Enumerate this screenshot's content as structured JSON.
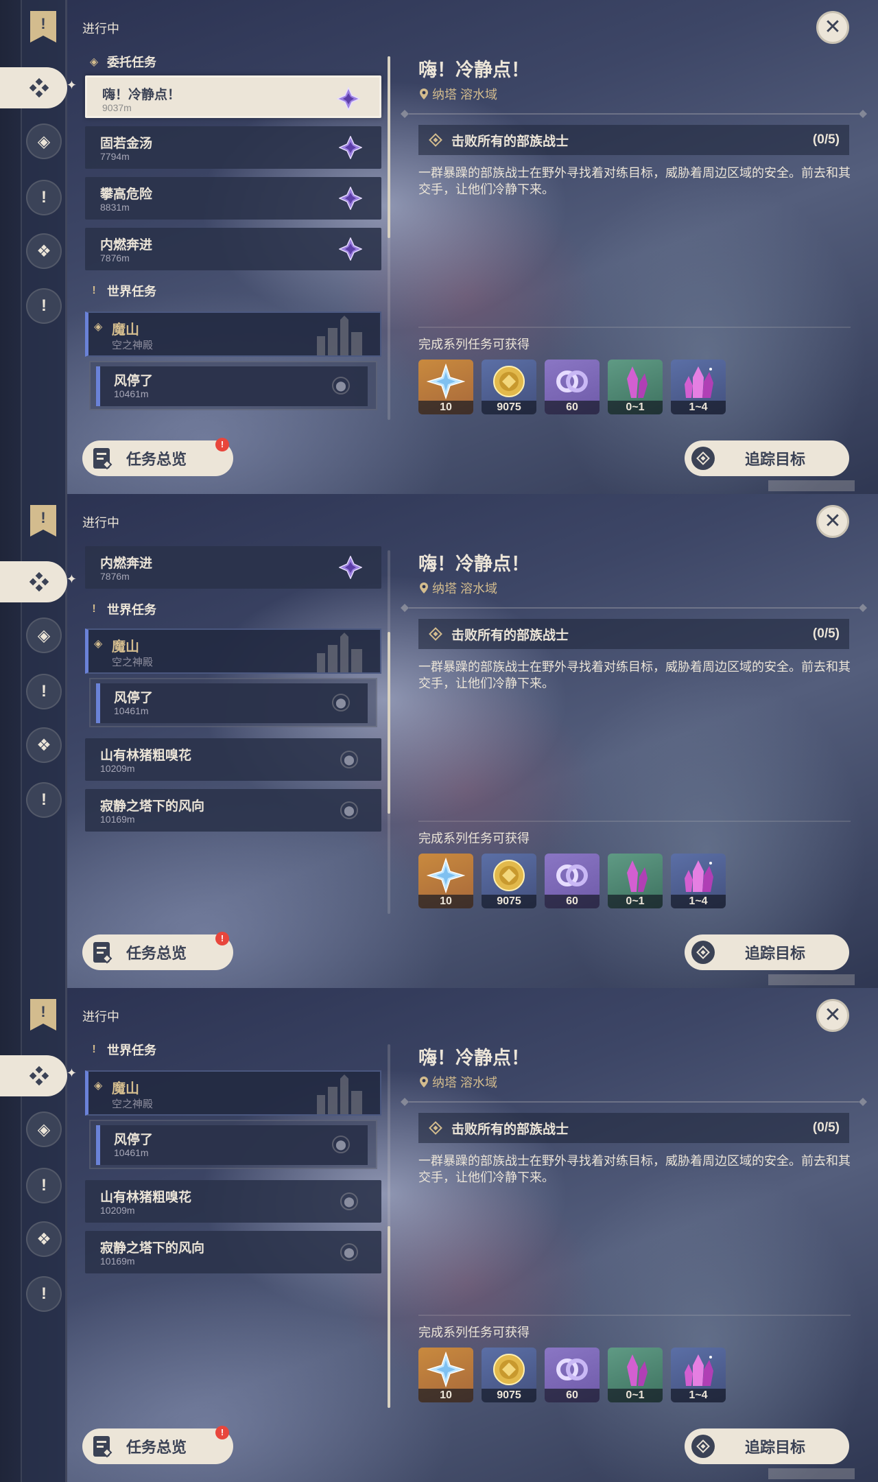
{
  "status_label": "进行中",
  "sections": {
    "commission": "委托任务",
    "world": "世界任务"
  },
  "commission_quests": [
    {
      "title": "嗨！冷静点！",
      "distance": "9037m"
    },
    {
      "title": "固若金汤",
      "distance": "7794m"
    },
    {
      "title": "攀高危险",
      "distance": "8831m"
    },
    {
      "title": "内燃奔进",
      "distance": "7876m"
    }
  ],
  "world_quest": {
    "title": "魔山",
    "subtitle": "空之神殿",
    "child": {
      "title": "风停了",
      "distance": "10461m"
    }
  },
  "other_world_quests": [
    {
      "title": "山有林猪粗嗅花",
      "distance": "10209m"
    },
    {
      "title": "寂静之塔下的风向",
      "distance": "10169m"
    }
  ],
  "detail": {
    "title": "嗨！冷静点！",
    "location": "纳塔 溶水域",
    "objective": "击败所有的部族战士",
    "progress": "(0/5)",
    "description": "一群暴躁的部族战士在野外寻找着对练目标，威胁着周边区域的安全。前去和其交手，让他们冷静下来。",
    "rewards_title": "完成系列任务可获得",
    "rewards": [
      {
        "icon": "primogem-icon",
        "count": "10",
        "bg": "orange"
      },
      {
        "icon": "mora-icon",
        "count": "9075",
        "bg": "blue"
      },
      {
        "icon": "friendship-icon",
        "count": "60",
        "bg": "purple"
      },
      {
        "icon": "crystal-chunk-icon",
        "count": "0~1",
        "bg": "green"
      },
      {
        "icon": "crystal-cluster-icon",
        "count": "1~4",
        "bg": "blue"
      }
    ]
  },
  "buttons": {
    "overview": "任务总览",
    "overview_badge": "!",
    "track": "追踪目标"
  },
  "icons": {
    "rail_banner": "quest-banner-icon",
    "close": "close-icon"
  },
  "colors": {
    "accent_gold": "#d3bc8e",
    "cream": "#ece5d8",
    "world_blue": "#6a82d8",
    "badge_red": "#e8463c"
  },
  "scroll": {
    "panel_1": 0.0,
    "panel_2": 0.45,
    "panel_3": 1.0
  }
}
